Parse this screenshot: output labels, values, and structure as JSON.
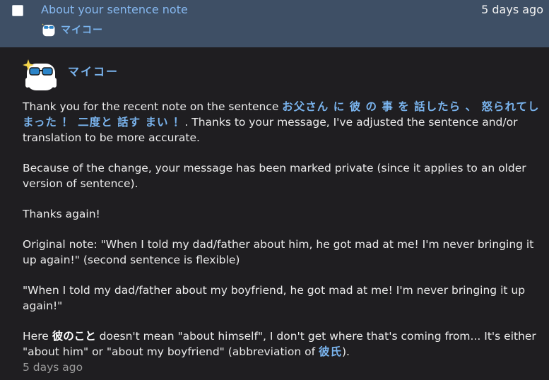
{
  "header": {
    "subject": "About your sentence note",
    "date": "5 days ago",
    "sender": "マイコー"
  },
  "message": {
    "sender": "マイコー",
    "p1_a": "Thank you for the recent note on the sentence ",
    "p1_jp": "お父さん に 彼 の 事 を 話したら 、 怒られてしまった ！ 二度と 話す まい ！",
    "p1_b": ". Thanks to your message, I've adjusted the sentence and/or translation to be more accurate.",
    "p2": "Because of the change, your message has been marked private (since it applies to an older version of sentence).",
    "p3": "Thanks again!",
    "p4": "Original note: \"When I told my dad/father about him, he got mad at me! I'm never bringing it up again!\" (second sentence is flexible)",
    "p5": "\"When I told my dad/father about my boyfriend, he got mad at me! I'm never bringing it up again!\"",
    "p6_a": "Here ",
    "p6_jp1": "彼のこと",
    "p6_b": " doesn't mean \"about himself\", I don't get where that's coming from... It's either \"about him\" or \"about my boyfriend\" (abbreviation of ",
    "p6_jp2": "彼氏",
    "p6_c": ").",
    "timestamp": "5 days ago"
  }
}
